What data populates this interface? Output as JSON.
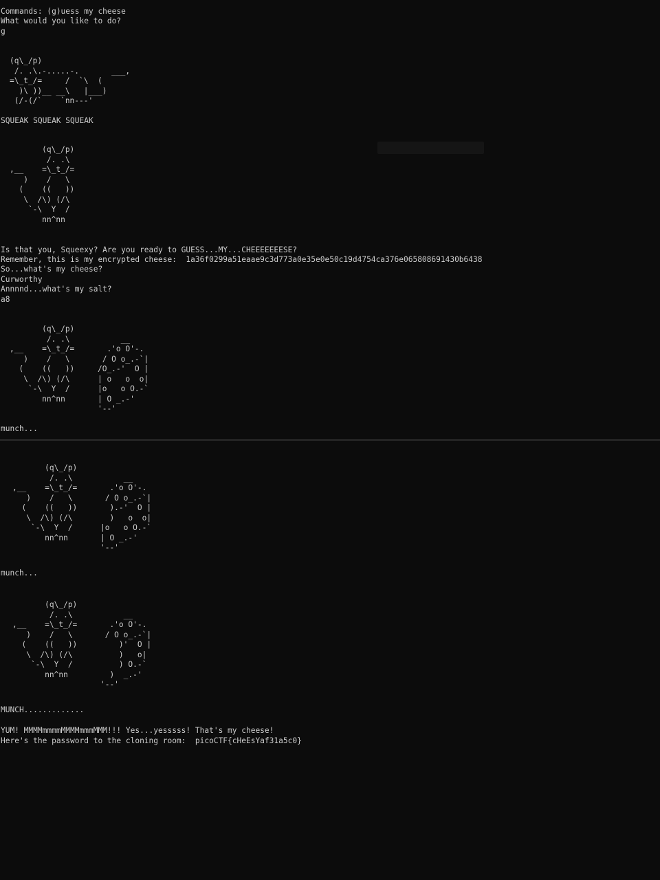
{
  "top": {
    "commands_line": "Commands: (g)uess my cheese",
    "prompt_line": "What would you like to do?",
    "user_choice": "g",
    "art_running_mouse": "(q\\_/p)\n /. .\\.-.....-.       ___,\n=\\_t_/=     /  `\\  (\n  )\\ ))__ __\\   |___)\n (/-(/`    `nn---'",
    "squeak_line": "SQUEAK SQUEAK SQUEAK",
    "art_sitting_mouse_1": "       (q\\_/p)\n        /. .\\\n,__    =\\_t_/=\n   )    /   \\\n  (    ((   ))\n   \\  /\\) (/\\\n    `-\\  Y  /\n       nn^nn",
    "question_line": "Is that you, Squeexy? Are you ready to GUESS...MY...CHEEEEEEESE?",
    "remember_line": "Remember, this is my encrypted cheese:  1a36f0299a51eaae9c3d773a0e35e0e50c19d4754ca376e065808691430b6438",
    "whats_cheese_line": "So...what's my cheese?",
    "cheese_answer": "Curworthy",
    "salt_question_line": "Annnnd...what's my salt?",
    "salt_answer": "a8",
    "art_mouse_cheese_1": "       (q\\_/p)\n        /. .\\           __\n,__    =\\_t_/=       .'o O'-.\n   )    /   \\       / O o_.-`|\n  (    ((   ))     /O_.-'  O |\n   \\  /\\) (/\\      | o   o  o|\n    `-\\  Y  /      |o   o O.-`\n       nn^nn       | O _.-'\n                   '--'",
    "munch_line_1": "munch..."
  },
  "bottom": {
    "art_mouse_cheese_2": "       (q\\_/p)\n        /. .\\           __\n,__    =\\_t_/=       .'o O'-.\n   )    /   \\       / O o_.-`|\n  (    ((   ))       ).-'  O |\n   \\  /\\) (/\\        )   o  o|\n    `-\\  Y  /      |o   o O.-`\n       nn^nn       | O _.-'\n                   '--'",
    "munch_line_2": "munch...",
    "art_mouse_cheese_3": "       (q\\_/p)\n        /. .\\           __\n,__    =\\_t_/=       .'o O'-.\n   )    /   \\       / O o_.-`|\n  (    ((   ))         )'  O |\n   \\  /\\) (/\\          )   o|\n    `-\\  Y  /          ) O.-`\n       nn^nn         )  _.-'\n                   '--'",
    "munch_line_3": "MUNCH.............",
    "yum_line": "YUM! MMMMmmmmMMMMmmmMMM!!! Yes...yesssss! That's my cheese!",
    "password_line": "Here's the password to the cloning room:  picoCTF{cHeEsYaf31a5c0}"
  }
}
